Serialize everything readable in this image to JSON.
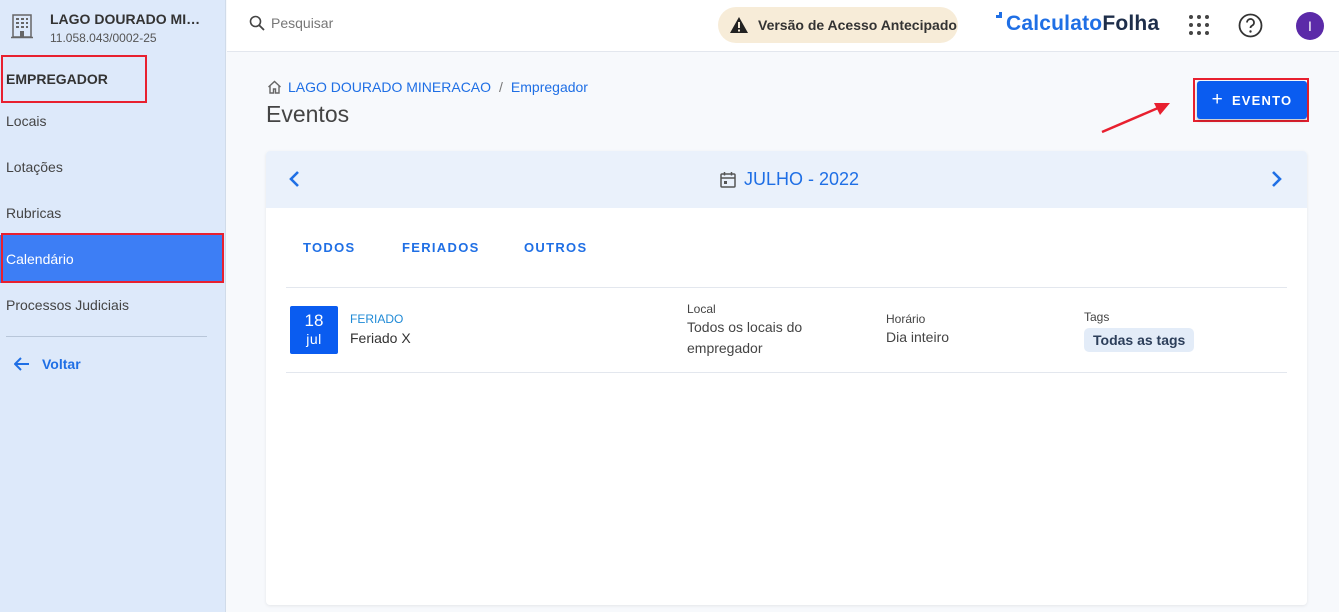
{
  "company": {
    "name": "LAGO DOURADO MINERACAO",
    "cnpj": "11.058.043/0002-25"
  },
  "sidebar": {
    "section_title": "EMPREGADOR",
    "items": [
      {
        "label": "Locais"
      },
      {
        "label": "Lotações"
      },
      {
        "label": "Rubricas"
      },
      {
        "label": "Calendário"
      },
      {
        "label": "Processos Judiciais"
      }
    ],
    "active_item": "Calendário",
    "back_label": "Voltar"
  },
  "topbar": {
    "search_placeholder": "Pesquisar",
    "badge_label": "Versão de Acesso Antecipado",
    "logo_part1": "Calculato",
    "logo_part2": "Folha",
    "avatar_initial": "I"
  },
  "breadcrumb": {
    "company": "LAGO DOURADO MINERACAO",
    "separator": "/",
    "current": "Empregador"
  },
  "page_title": "Eventos",
  "evento_button": {
    "plus": "+",
    "label": "EVENTO"
  },
  "calendar": {
    "month_label": "JULHO - 2022",
    "tabs": [
      {
        "label": "TODOS"
      },
      {
        "label": "FERIADOS"
      },
      {
        "label": "OUTROS"
      }
    ],
    "events": [
      {
        "day": "18",
        "month": "jul",
        "type": "FERIADO",
        "name": "Feriado X",
        "local_label": "Local",
        "local_line1": "Todos os locais do",
        "local_line2": "empregador",
        "time_label": "Horário",
        "time_value": "Dia inteiro",
        "tags_label": "Tags",
        "tag_value": "Todas as tags"
      }
    ]
  },
  "colors": {
    "primary": "#0a5cf0",
    "highlight_box": "#e8202f",
    "sidebar_bg": "#dde9fa",
    "active_item": "#3d7ef5"
  }
}
